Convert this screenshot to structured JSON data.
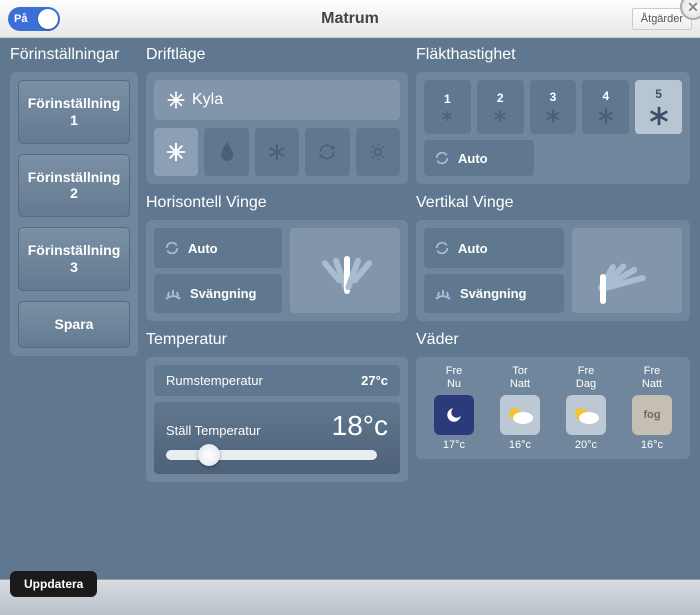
{
  "header": {
    "toggle_label": "På",
    "title": "Matrum",
    "actions_label": "Åtgärder"
  },
  "presets": {
    "title": "Förinställningar",
    "items": [
      "Förinställning 1",
      "Förinställning 2",
      "Förinställning 3"
    ],
    "save_label": "Spara"
  },
  "mode": {
    "title": "Driftläge",
    "current": "Kyla",
    "icons": [
      "snowflake",
      "drop",
      "asterisk",
      "recycle",
      "sun"
    ],
    "active_index": 0
  },
  "fan": {
    "title": "Fläkthastighet",
    "speeds": [
      "1",
      "2",
      "3",
      "4",
      "5"
    ],
    "active_index": 4,
    "auto_label": "Auto"
  },
  "hvane": {
    "title": "Horisontell Vinge",
    "auto_label": "Auto",
    "swing_label": "Svängning"
  },
  "vvane": {
    "title": "Vertikal Vinge",
    "auto_label": "Auto",
    "swing_label": "Svängning"
  },
  "temp": {
    "title": "Temperatur",
    "room_label": "Rumstemperatur",
    "room_value": "27°c",
    "set_label": "Ställ Temperatur",
    "set_value": "18°c"
  },
  "weather": {
    "title": "Väder",
    "items": [
      {
        "line1": "Fre",
        "line2": "Nu",
        "icon": "night",
        "temp": "17°c"
      },
      {
        "line1": "Tor",
        "line2": "Natt",
        "icon": "cloud",
        "temp": "16°c"
      },
      {
        "line1": "Fre",
        "line2": "Dag",
        "icon": "cloud",
        "temp": "20°c"
      },
      {
        "line1": "Fre",
        "line2": "Natt",
        "icon": "fog",
        "temp": "16°c"
      }
    ]
  },
  "footer": {
    "update_label": "Uppdatera"
  }
}
